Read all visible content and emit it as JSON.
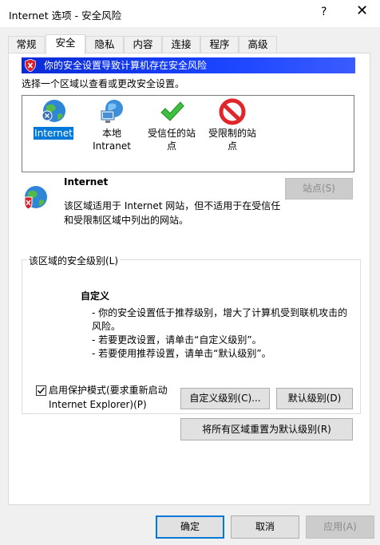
{
  "window": {
    "title": "Internet 选项 - 安全风险",
    "help_glyph": "?",
    "close_glyph": "✕"
  },
  "tabs": [
    {
      "label": "常规"
    },
    {
      "label": "安全"
    },
    {
      "label": "隐私"
    },
    {
      "label": "内容"
    },
    {
      "label": "连接"
    },
    {
      "label": "程序"
    },
    {
      "label": "高级"
    }
  ],
  "warning": {
    "text": "你的安全设置导致计算机存在安全风险",
    "icon": "shield-warning-icon"
  },
  "zone_select_label": "选择一个区域以查看或更改安全设置。",
  "zones": [
    {
      "label": "Internet",
      "icon": "globe-icon",
      "selected": true
    },
    {
      "label": "本地 Intranet",
      "icon": "intranet-icon",
      "selected": false
    },
    {
      "label": "受信任的站点",
      "icon": "check-icon",
      "selected": false
    },
    {
      "label": "受限制的站点",
      "icon": "restricted-icon",
      "selected": false
    }
  ],
  "zone_info": {
    "title": "Internet",
    "description": "该区域适用于 Internet 网站，但不适用于在受信任和受限制区域中列出的网站。",
    "sites_button": "站点(S)"
  },
  "security_level": {
    "group_label": "该区域的安全级别(L)",
    "custom_title": "自定义",
    "lines": [
      "- 你的安全设置低于推荐级别，增大了计算机受到联机攻击的风险。",
      "- 若要更改设置，请单击“自定义级别”。",
      "- 若要使用推荐设置，请单击“默认级别”。"
    ],
    "protected_mode_label": "启用保护模式(要求重新启动 Internet Explorer)(P)",
    "protected_mode_checked": true,
    "custom_level_button": "自定义级别(C)...",
    "default_level_button": "默认级别(D)",
    "reset_all_button": "将所有区域重置为默认级别(R)"
  },
  "footer": {
    "ok": "确定",
    "cancel": "取消",
    "apply": "应用(A)"
  },
  "colors": {
    "warning_bar": "#1a3cf0",
    "selection": "#0078d7",
    "ok_border": "#0078d7"
  }
}
